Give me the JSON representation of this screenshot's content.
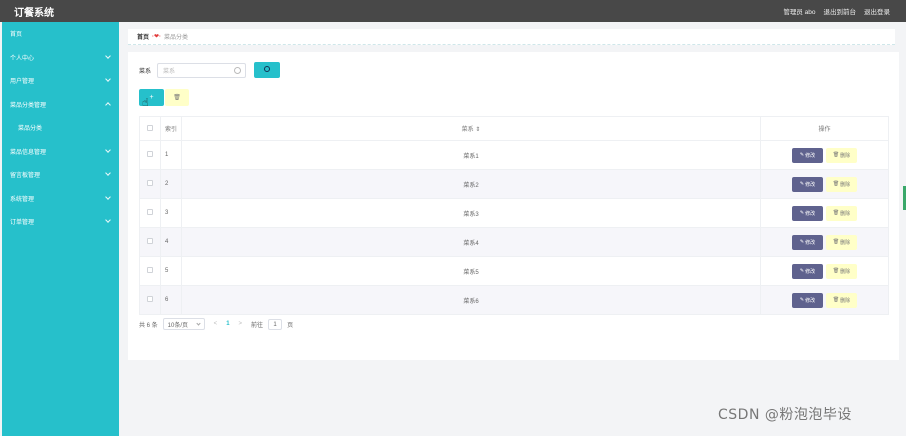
{
  "app": {
    "title": "订餐系统"
  },
  "header": {
    "admin_label": "管理员 abo",
    "front_link": "退出到前台",
    "logout": "退出登录"
  },
  "sidebar": {
    "items": [
      {
        "label": "首页",
        "has_arrow": false
      },
      {
        "label": "个人中心",
        "has_arrow": true
      },
      {
        "label": "用户管理",
        "has_arrow": true
      },
      {
        "label": "菜品分类管理",
        "has_arrow": true,
        "expanded": true
      },
      {
        "label": "菜品分类",
        "sub": true
      },
      {
        "label": "菜品信息管理",
        "has_arrow": true
      },
      {
        "label": "留言板管理",
        "has_arrow": true
      },
      {
        "label": "系统管理",
        "has_arrow": true
      },
      {
        "label": "订单管理",
        "has_arrow": true
      }
    ]
  },
  "breadcrumb": {
    "home": "首页",
    "current": "菜品分类"
  },
  "search": {
    "label": "菜系",
    "placeholder": "菜系"
  },
  "toolbar": {
    "add_glyph": "+",
    "delete_glyph": "🗑"
  },
  "table": {
    "headers": {
      "index": "索引",
      "name": "菜系 ⇕",
      "actions": "操作"
    },
    "rows": [
      {
        "index": "1",
        "name": "菜系1"
      },
      {
        "index": "2",
        "name": "菜系2"
      },
      {
        "index": "3",
        "name": "菜系3"
      },
      {
        "index": "4",
        "name": "菜系4"
      },
      {
        "index": "5",
        "name": "菜系5"
      },
      {
        "index": "6",
        "name": "菜系6"
      }
    ],
    "edit_label": "修改",
    "delete_label": "删除"
  },
  "pagination": {
    "total": "共 6 条",
    "page_size": "10条/页",
    "prev": "<",
    "current": "1",
    "next": ">",
    "goto_label": "前往",
    "goto_value": "1",
    "goto_suffix": "页"
  },
  "watermark": "CSDN @粉泡泡毕设",
  "colors": {
    "accent": "#26c0cb",
    "topbar": "#484848",
    "edit": "#5f628e",
    "delete": "#ffffc8"
  }
}
